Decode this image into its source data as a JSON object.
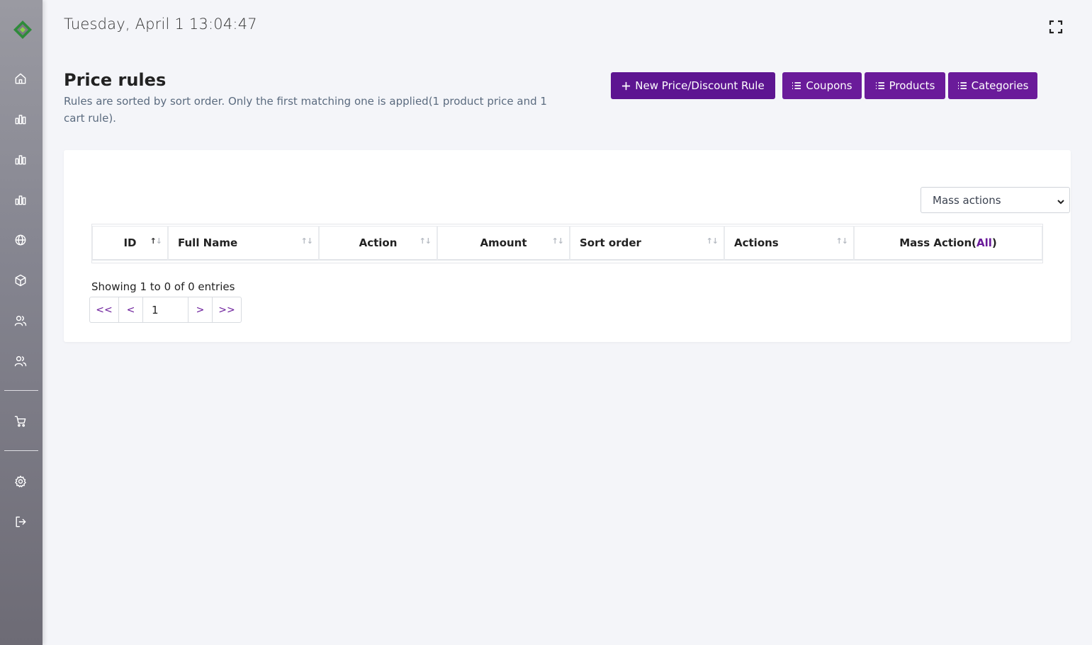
{
  "header": {
    "datetime": "Tuesday, April 1 13:04:47"
  },
  "page": {
    "title": "Price rules",
    "subtitle": "Rules are sorted by sort order. Only the first matching one is applied(1 product price and 1 cart rule)."
  },
  "toolbar": {
    "new_rule_label": "New Price/Discount Rule",
    "coupons_label": "Coupons",
    "products_label": "Products",
    "categories_label": "Categories"
  },
  "table": {
    "mass_actions_select": "Mass actions",
    "columns": {
      "id": "ID",
      "full_name": "Full Name",
      "action": "Action",
      "amount": "Amount",
      "sort_order": "Sort order",
      "actions": "Actions",
      "mass_action": "Mass Action(",
      "mass_action_all": "All",
      "mass_action_close": ")"
    },
    "rows": [],
    "showing": "Showing 1 to 0 of 0 entries"
  },
  "pagination": {
    "first": "<<",
    "prev": "<",
    "current_page": "1",
    "next": ">",
    "last": ">>"
  },
  "colors": {
    "primary": "#6a1b9a",
    "primary_dark": "#5d1591",
    "background": "#f4f5f9"
  },
  "sidebar": {
    "icons": [
      "home-icon",
      "bar-chart-icon",
      "bar-chart-icon",
      "bar-chart-icon",
      "globe-icon",
      "box-icon",
      "users-icon",
      "users-icon",
      "cart-icon",
      "gear-icon",
      "logout-icon"
    ]
  }
}
